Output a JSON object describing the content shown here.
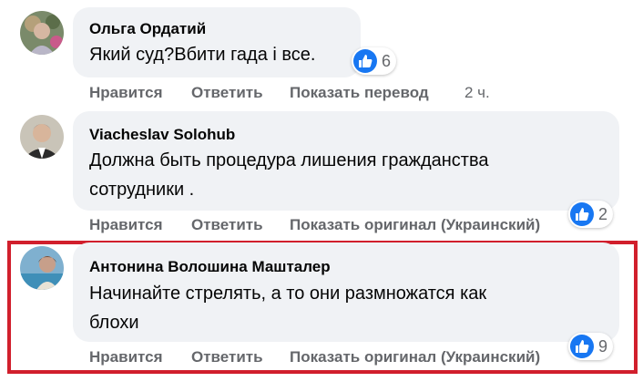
{
  "colors": {
    "accent": "#1877f2",
    "highlight": "#d11f2c",
    "bubble": "#f0f2f5",
    "meta": "#65676b"
  },
  "comments": [
    {
      "author": "Ольга Ордатий",
      "text": "Який суд?Вбити гада і все.",
      "actions": {
        "like": "Нравится",
        "reply": "Ответить",
        "translate": "Показать перевод",
        "time": "2 ч."
      },
      "reaction": {
        "icon": "thumbs-up-icon",
        "count": "6"
      }
    },
    {
      "author": "Viacheslav Solohub",
      "text_lines": [
        "Должна быть процедура лишения гражданства",
        "сотрудники ."
      ],
      "actions": {
        "like": "Нравится",
        "reply": "Ответить",
        "translate": "Показать оригинал (Украинский)"
      },
      "reaction": {
        "icon": "thumbs-up-icon",
        "count": "2"
      }
    },
    {
      "author": "Антонина Волошина Машталер",
      "text_lines": [
        "Начинайте стрелять, а то они размножатся как",
        "блохи"
      ],
      "actions": {
        "like": "Нравится",
        "reply": "Ответить",
        "translate": "Показать оригинал (Украинский)"
      },
      "reaction": {
        "icon": "thumbs-up-icon",
        "count": "9"
      }
    }
  ]
}
